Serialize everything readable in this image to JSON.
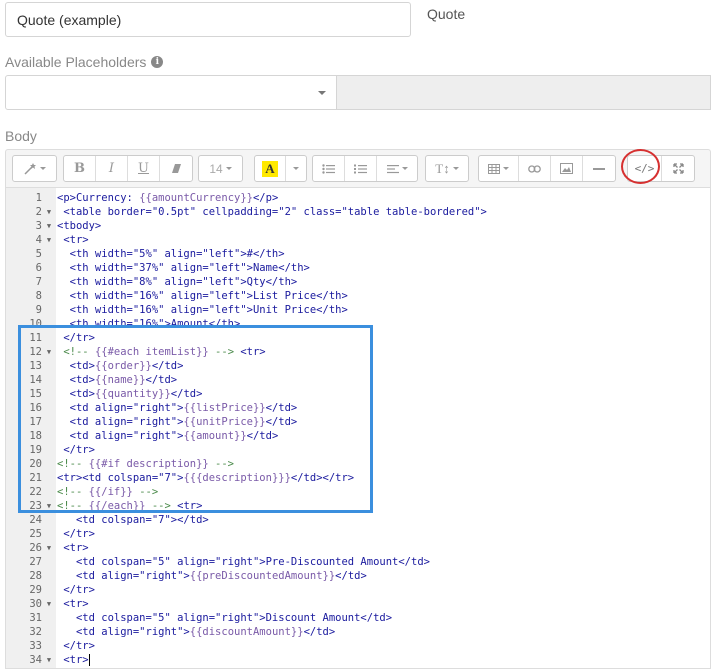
{
  "form": {
    "name_value": "Quote (example)",
    "type_label": "Quote",
    "placeholders_label": "Available Placeholders",
    "body_label": "Body"
  },
  "toolbar": {
    "font_size": "14",
    "highlight_letter": "A",
    "codeview_label": "</>",
    "buttons": [
      "magic-wand",
      "bold",
      "italic",
      "underline",
      "eraser",
      "font-size",
      "color",
      "unordered-list",
      "ordered-list",
      "paragraph-align",
      "text-height",
      "table",
      "link",
      "picture",
      "horizontal-rule",
      "codeview",
      "fullscreen"
    ]
  },
  "code_lines": [
    {
      "n": "1",
      "fold": "",
      "segs": [
        {
          "t": "<p>Currency: ",
          "c": "tag"
        },
        {
          "t": "{{amountCurrency}}",
          "c": "hb"
        },
        {
          "t": "</p>",
          "c": "tag"
        }
      ]
    },
    {
      "n": "2",
      "fold": "▼",
      "segs": [
        {
          "t": " <table border=\"0.5pt\" cellpadding=\"2\" class=\"table table-bordered\">",
          "c": "tag"
        }
      ]
    },
    {
      "n": "3",
      "fold": "▼",
      "segs": [
        {
          "t": "<tbody>",
          "c": "tag"
        }
      ]
    },
    {
      "n": "4",
      "fold": "▼",
      "segs": [
        {
          "t": " <tr>",
          "c": "tag"
        }
      ]
    },
    {
      "n": "5",
      "fold": "",
      "segs": [
        {
          "t": "  <th width=\"5%\" align=\"left\">#</th>",
          "c": "tag"
        }
      ]
    },
    {
      "n": "6",
      "fold": "",
      "segs": [
        {
          "t": "  <th width=\"37%\" align=\"left\">Name</th>",
          "c": "tag"
        }
      ]
    },
    {
      "n": "7",
      "fold": "",
      "segs": [
        {
          "t": "  <th width=\"8%\" align=\"left\">Qty</th>",
          "c": "tag"
        }
      ]
    },
    {
      "n": "8",
      "fold": "",
      "segs": [
        {
          "t": "  <th width=\"16%\" align=\"left\">List Price</th>",
          "c": "tag"
        }
      ]
    },
    {
      "n": "9",
      "fold": "",
      "segs": [
        {
          "t": "  <th width=\"16%\" align=\"left\">Unit Price</th>",
          "c": "tag"
        }
      ]
    },
    {
      "n": "10",
      "fold": "",
      "segs": [
        {
          "t": "  <th width=\"16%\">Amount</th>",
          "c": "tag"
        }
      ]
    },
    {
      "n": "11",
      "fold": "",
      "segs": [
        {
          "t": " </tr>",
          "c": "tag"
        }
      ]
    },
    {
      "n": "12",
      "fold": "▼",
      "segs": [
        {
          "t": " <!-- ",
          "c": "cmt"
        },
        {
          "t": "{{#each itemList}}",
          "c": "hb"
        },
        {
          "t": " --> ",
          "c": "cmt"
        },
        {
          "t": "<tr>",
          "c": "tag"
        }
      ]
    },
    {
      "n": "13",
      "fold": "",
      "segs": [
        {
          "t": "  <td>",
          "c": "tag"
        },
        {
          "t": "{{order}}",
          "c": "hb"
        },
        {
          "t": "</td>",
          "c": "tag"
        }
      ]
    },
    {
      "n": "14",
      "fold": "",
      "segs": [
        {
          "t": "  <td>",
          "c": "tag"
        },
        {
          "t": "{{name}}",
          "c": "hb"
        },
        {
          "t": "</td>",
          "c": "tag"
        }
      ]
    },
    {
      "n": "15",
      "fold": "",
      "segs": [
        {
          "t": "  <td>",
          "c": "tag"
        },
        {
          "t": "{{quantity}}",
          "c": "hb"
        },
        {
          "t": "</td>",
          "c": "tag"
        }
      ]
    },
    {
      "n": "16",
      "fold": "",
      "segs": [
        {
          "t": "  <td align=\"right\">",
          "c": "tag"
        },
        {
          "t": "{{listPrice}}",
          "c": "hb"
        },
        {
          "t": "</td>",
          "c": "tag"
        }
      ]
    },
    {
      "n": "17",
      "fold": "",
      "segs": [
        {
          "t": "  <td align=\"right\">",
          "c": "tag"
        },
        {
          "t": "{{unitPrice}}",
          "c": "hb"
        },
        {
          "t": "</td>",
          "c": "tag"
        }
      ]
    },
    {
      "n": "18",
      "fold": "",
      "segs": [
        {
          "t": "  <td align=\"right\">",
          "c": "tag"
        },
        {
          "t": "{{amount}}",
          "c": "hb"
        },
        {
          "t": "</td>",
          "c": "tag"
        }
      ]
    },
    {
      "n": "19",
      "fold": "",
      "segs": [
        {
          "t": " </tr>",
          "c": "tag"
        }
      ]
    },
    {
      "n": "20",
      "fold": "",
      "segs": [
        {
          "t": "<!-- ",
          "c": "cmt"
        },
        {
          "t": "{{#if description}}",
          "c": "hb"
        },
        {
          "t": " -->",
          "c": "cmt"
        }
      ]
    },
    {
      "n": "21",
      "fold": "",
      "segs": [
        {
          "t": "<tr><td colspan=\"7\">",
          "c": "tag"
        },
        {
          "t": "{{{description}}}",
          "c": "hb"
        },
        {
          "t": "</td></tr>",
          "c": "tag"
        }
      ]
    },
    {
      "n": "22",
      "fold": "",
      "segs": [
        {
          "t": "<!-- ",
          "c": "cmt"
        },
        {
          "t": "{{/if}}",
          "c": "hb"
        },
        {
          "t": " -->",
          "c": "cmt"
        }
      ]
    },
    {
      "n": "23",
      "fold": "▼",
      "segs": [
        {
          "t": "<!-- ",
          "c": "cmt"
        },
        {
          "t": "{{/each}}",
          "c": "hb"
        },
        {
          "t": " --> ",
          "c": "cmt"
        },
        {
          "t": "<tr>",
          "c": "tag"
        }
      ]
    },
    {
      "n": "24",
      "fold": "",
      "segs": [
        {
          "t": "   <td colspan=\"7\"></td>",
          "c": "tag"
        }
      ]
    },
    {
      "n": "25",
      "fold": "",
      "segs": [
        {
          "t": " </tr>",
          "c": "tag"
        }
      ]
    },
    {
      "n": "26",
      "fold": "▼",
      "segs": [
        {
          "t": " <tr>",
          "c": "tag"
        }
      ]
    },
    {
      "n": "27",
      "fold": "",
      "segs": [
        {
          "t": "   <td colspan=\"5\" align=\"right\">Pre-Discounted Amount</td>",
          "c": "tag"
        }
      ]
    },
    {
      "n": "28",
      "fold": "",
      "segs": [
        {
          "t": "   <td align=\"right\">",
          "c": "tag"
        },
        {
          "t": "{{preDiscountedAmount}}",
          "c": "hb"
        },
        {
          "t": "</td>",
          "c": "tag"
        }
      ]
    },
    {
      "n": "29",
      "fold": "",
      "segs": [
        {
          "t": " </tr>",
          "c": "tag"
        }
      ]
    },
    {
      "n": "30",
      "fold": "▼",
      "segs": [
        {
          "t": " <tr>",
          "c": "tag"
        }
      ]
    },
    {
      "n": "31",
      "fold": "",
      "segs": [
        {
          "t": "   <td colspan=\"5\" align=\"right\">Discount Amount</td>",
          "c": "tag"
        }
      ]
    },
    {
      "n": "32",
      "fold": "",
      "segs": [
        {
          "t": "   <td align=\"right\">",
          "c": "tag"
        },
        {
          "t": "{{discountAmount}}",
          "c": "hb"
        },
        {
          "t": "</td>",
          "c": "tag"
        }
      ]
    },
    {
      "n": "33",
      "fold": "",
      "segs": [
        {
          "t": " </tr>",
          "c": "tag"
        }
      ]
    },
    {
      "n": "34",
      "fold": "▼",
      "segs": [
        {
          "t": " <tr>",
          "c": "tag"
        }
      ],
      "cursor": true
    }
  ]
}
